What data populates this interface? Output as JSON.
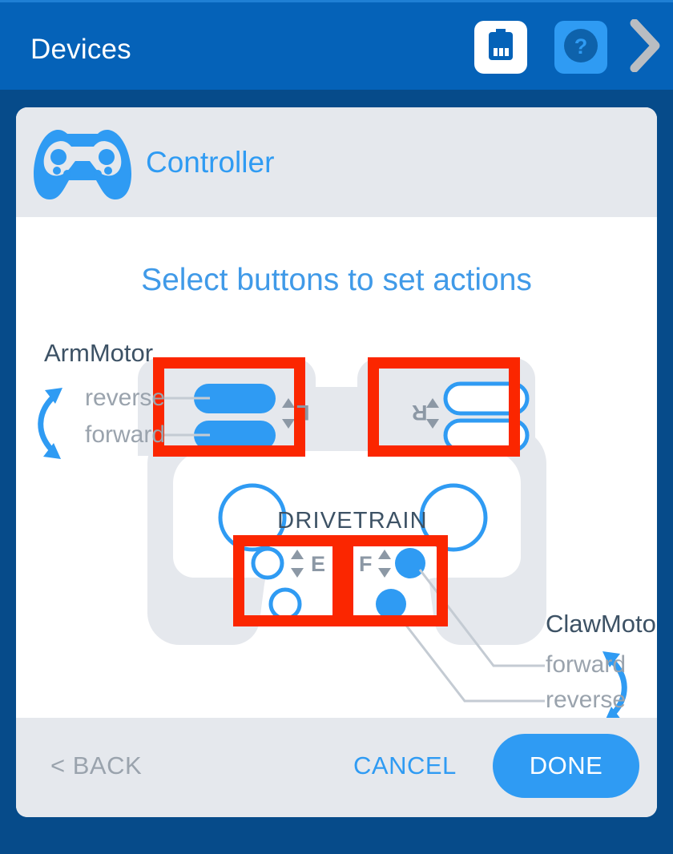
{
  "header": {
    "title": "Devices",
    "battery_icon": "battery-icon",
    "help_icon": "help-question-icon",
    "next_icon": "chevron-right-icon"
  },
  "card": {
    "icon": "gamepad-icon",
    "title": "Controller",
    "subtitle": "Select buttons to set actions"
  },
  "diagram": {
    "drivetrain_label": "DRIVETRAIN",
    "left_motor": {
      "name": "ArmMotor",
      "actions": [
        "reverse",
        "forward"
      ],
      "button_group": "L",
      "arrow_icon": "curved-double-arrow-icon"
    },
    "right_motor": {
      "name": "ClawMotor",
      "actions": [
        "forward",
        "reverse"
      ],
      "button_group": "F",
      "arrow_icon": "curved-double-arrow-icon"
    },
    "groups": [
      {
        "id": "L",
        "label": "L",
        "assigned": true,
        "highlighted": true
      },
      {
        "id": "R",
        "label": "R",
        "assigned": false,
        "highlighted": true
      },
      {
        "id": "E",
        "label": "E",
        "assigned": false,
        "highlighted": true
      },
      {
        "id": "F",
        "label": "F",
        "assigned": true,
        "highlighted": true
      }
    ],
    "updown_icon": "up-down-arrows-icon"
  },
  "footer": {
    "back_label": "< BACK",
    "cancel_label": "CANCEL",
    "done_label": "DONE"
  },
  "colors": {
    "header_blue": "#0562b8",
    "page_blue": "#064b8a",
    "accent_blue": "#2f9bf3",
    "highlight_red": "#fb2600",
    "body_gray": "#e5e8ed",
    "label_gray": "#9aa3ad",
    "dark_text": "#3d5265"
  }
}
